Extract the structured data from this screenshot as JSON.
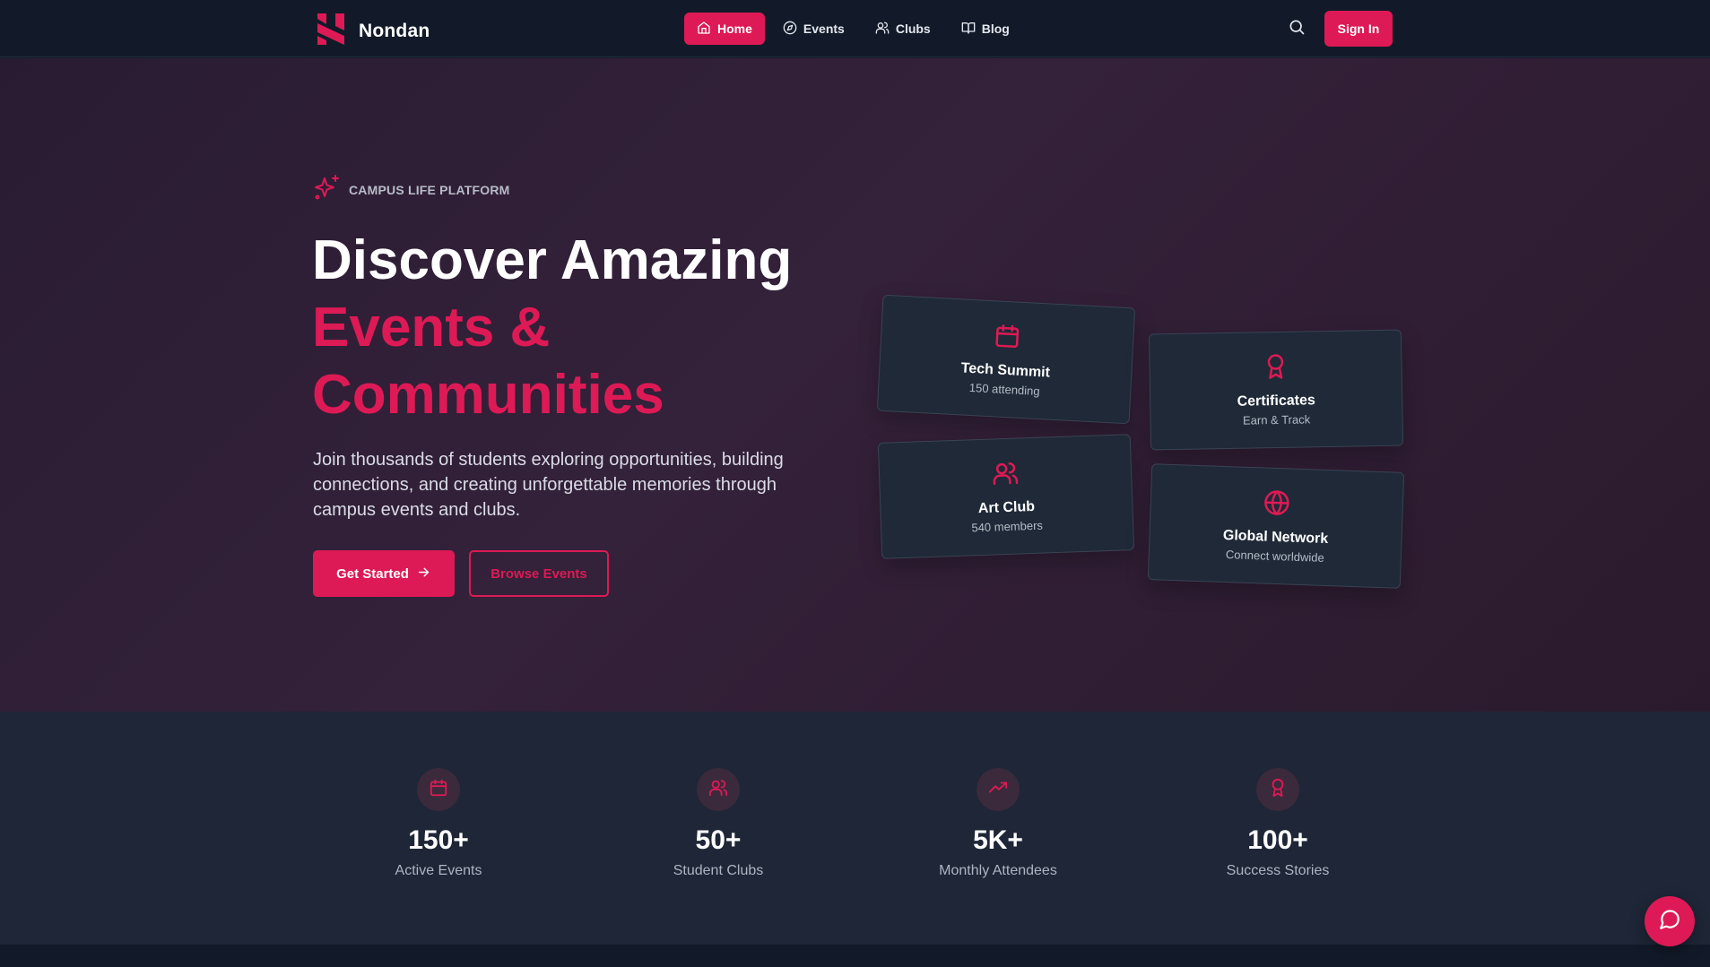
{
  "brand": {
    "name": "Nondan",
    "logo_icon": "nondan-logo-icon",
    "accent_color": "#dd1a55"
  },
  "nav": {
    "items": [
      {
        "label": "Home",
        "icon": "home-icon",
        "active": true
      },
      {
        "label": "Events",
        "icon": "compass-icon",
        "active": false
      },
      {
        "label": "Clubs",
        "icon": "users-icon",
        "active": false
      },
      {
        "label": "Blog",
        "icon": "book-open-icon",
        "active": false
      }
    ],
    "search_icon": "search-icon",
    "signin_label": "Sign In"
  },
  "hero": {
    "eyebrow_icon": "sparkles-icon",
    "eyebrow": "CAMPUS LIFE PLATFORM",
    "headline_line1": "Discover Amazing",
    "headline_line2": "Events &",
    "headline_line3": "Communities",
    "description": "Join thousands of students exploring opportunities, building connections, and creating unforgettable memories through campus events and clubs.",
    "primary_cta": "Get Started",
    "primary_cta_icon": "arrow-right-icon",
    "secondary_cta": "Browse Events"
  },
  "cards": [
    {
      "icon": "calendar-icon",
      "title": "Tech Summit",
      "subtitle": "150 attending"
    },
    {
      "icon": "award-icon",
      "title": "Certificates",
      "subtitle": "Earn & Track"
    },
    {
      "icon": "users-icon",
      "title": "Art Club",
      "subtitle": "540 members"
    },
    {
      "icon": "globe-icon",
      "title": "Global Network",
      "subtitle": "Connect worldwide"
    }
  ],
  "stats": [
    {
      "icon": "calendar-icon",
      "value": "150+",
      "label": "Active Events"
    },
    {
      "icon": "users-icon",
      "value": "50+",
      "label": "Student Clubs"
    },
    {
      "icon": "trending-up-icon",
      "value": "5K+",
      "label": "Monthly Attendees"
    },
    {
      "icon": "award-icon",
      "value": "100+",
      "label": "Success Stories"
    }
  ],
  "chat_icon": "chat-bubble-icon"
}
